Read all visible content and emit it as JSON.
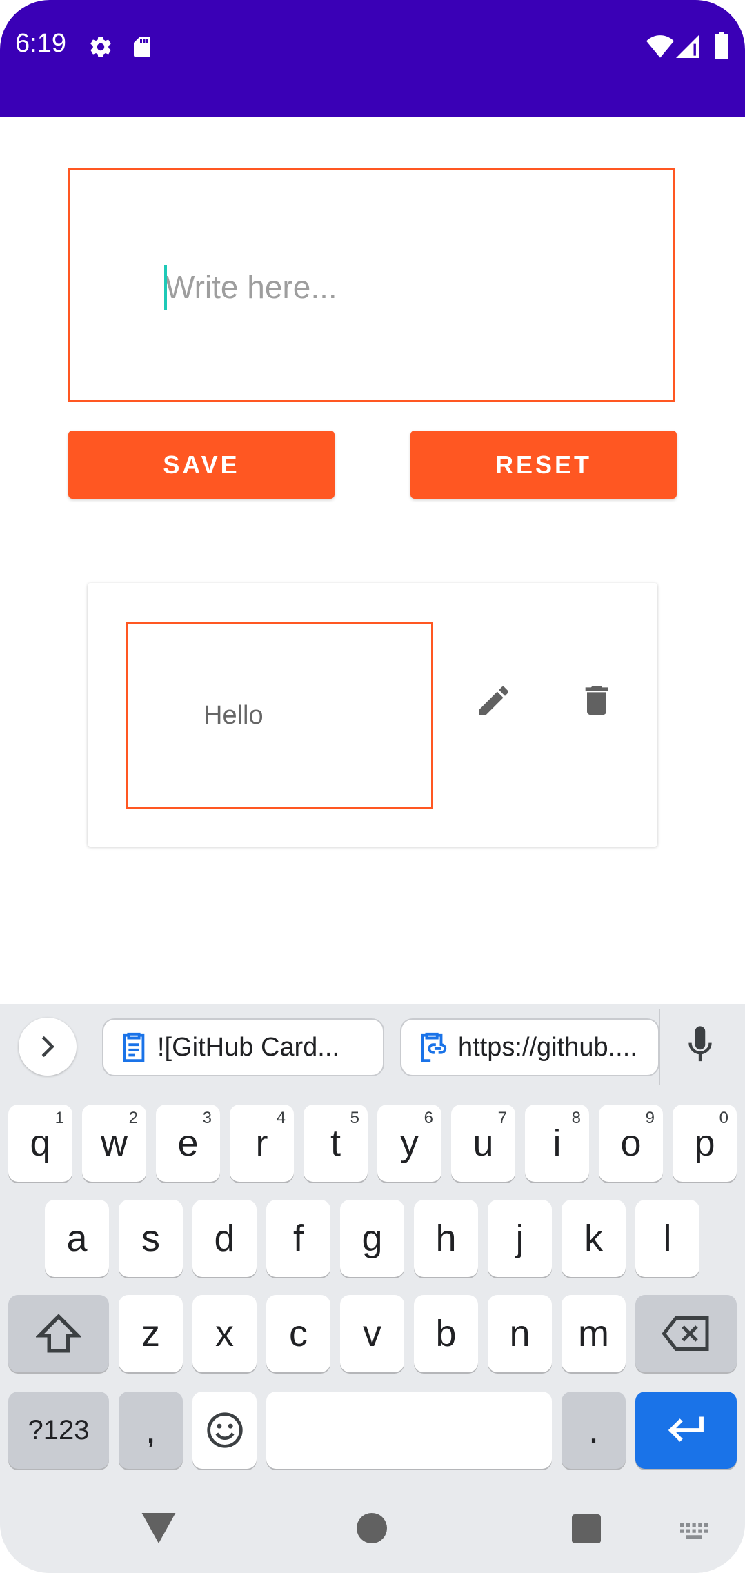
{
  "status_bar": {
    "time": "6:19",
    "icons": [
      "settings-icon",
      "sd-card-icon",
      "wifi-icon",
      "signal-icon",
      "battery-icon"
    ],
    "background": "#3a00b6"
  },
  "editor": {
    "placeholder": "Write here...",
    "value": "",
    "save_label": "SAVE",
    "reset_label": "RESET",
    "accent": "#ff5722"
  },
  "notes": [
    {
      "text": "Hello",
      "actions": [
        "edit-icon",
        "delete-icon"
      ]
    }
  ],
  "keyboard": {
    "suggestions": [
      "![GitHub Card...",
      "https://github...."
    ],
    "row1": [
      {
        "key": "q",
        "hint": "1"
      },
      {
        "key": "w",
        "hint": "2"
      },
      {
        "key": "e",
        "hint": "3"
      },
      {
        "key": "r",
        "hint": "4"
      },
      {
        "key": "t",
        "hint": "5"
      },
      {
        "key": "y",
        "hint": "6"
      },
      {
        "key": "u",
        "hint": "7"
      },
      {
        "key": "i",
        "hint": "8"
      },
      {
        "key": "o",
        "hint": "9"
      },
      {
        "key": "p",
        "hint": "0"
      }
    ],
    "row2": [
      "a",
      "s",
      "d",
      "f",
      "g",
      "h",
      "j",
      "k",
      "l"
    ],
    "row3": [
      "z",
      "x",
      "c",
      "v",
      "b",
      "n",
      "m"
    ],
    "symbols_label": "?123",
    "comma": ",",
    "period": ".",
    "enter_color": "#1a73e8"
  }
}
